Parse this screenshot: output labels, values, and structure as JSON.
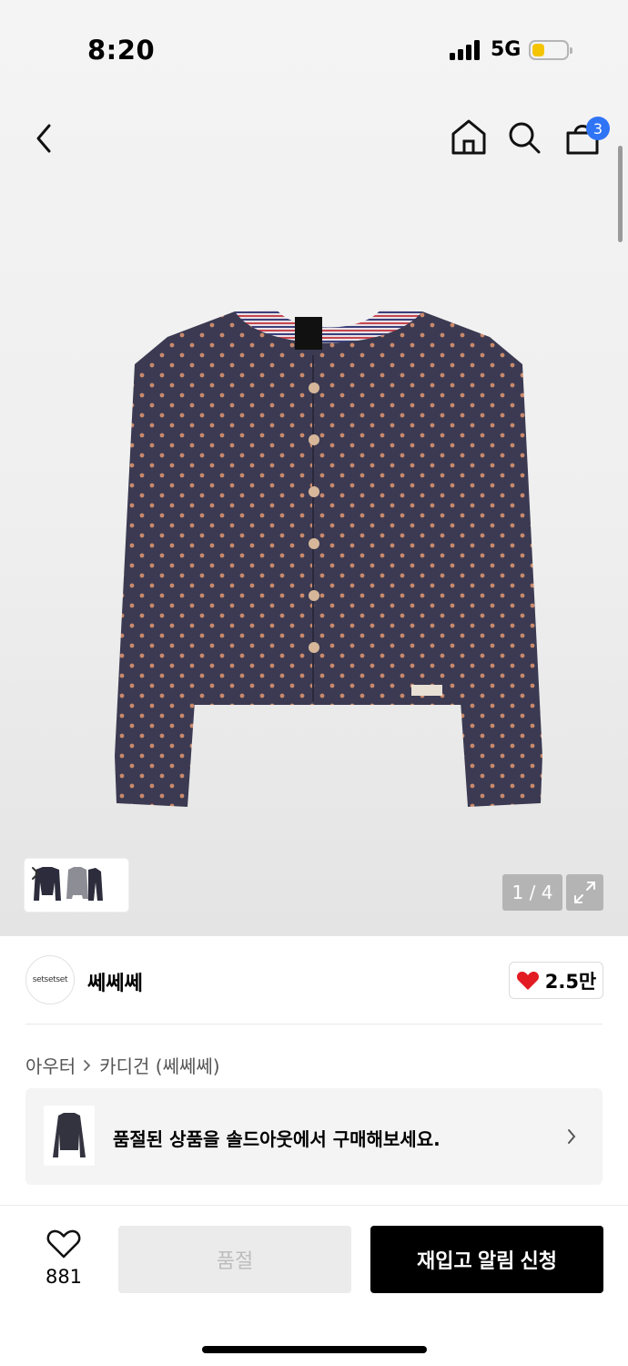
{
  "status_bar": {
    "time": "8:20",
    "network": "5G",
    "battery_level": 0.35,
    "battery_color": "#f5c400"
  },
  "nav": {
    "icons": [
      "back-icon",
      "home-icon",
      "search-icon",
      "shopping-bag-icon"
    ],
    "cart_count": "3",
    "cart_badge_color": "#2f74f5"
  },
  "gallery": {
    "counter": "1 / 4",
    "icons": [
      "expand-icon",
      "chevron-right-icon"
    ]
  },
  "brand": {
    "logo_text": "setsetset",
    "name": "쎄쎄쎄",
    "likes": "2.5만",
    "like_color": "#e31b23"
  },
  "breadcrumb": {
    "category": "아우터",
    "subcategory": "카디건 (쎄쎄쎄)"
  },
  "banner": {
    "text": "품절된 상품을 솔드아웃에서 구매해보세요."
  },
  "bottom_bar": {
    "wish_count": "881",
    "soldout_label": "품절",
    "restock_label": "재입고 알림 신청"
  }
}
